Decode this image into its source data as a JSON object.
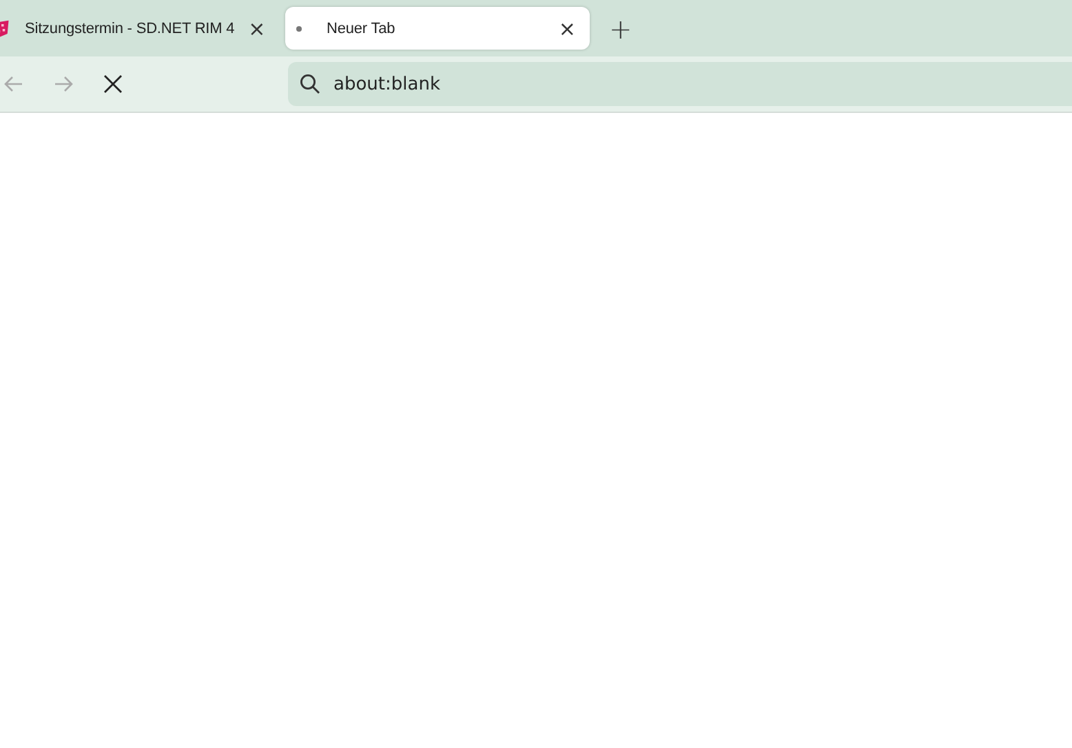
{
  "tabs": [
    {
      "title": "Sitzungstermin - SD.NET RIM 4",
      "selected": false,
      "loading": false,
      "close": "×"
    },
    {
      "title": "Neuer Tab",
      "selected": true,
      "loading": true,
      "close": "×"
    }
  ],
  "new_tab": "+",
  "toolbar": {
    "back_disabled": true,
    "forward_disabled": true
  },
  "address_bar": {
    "value": "about:blank"
  }
}
